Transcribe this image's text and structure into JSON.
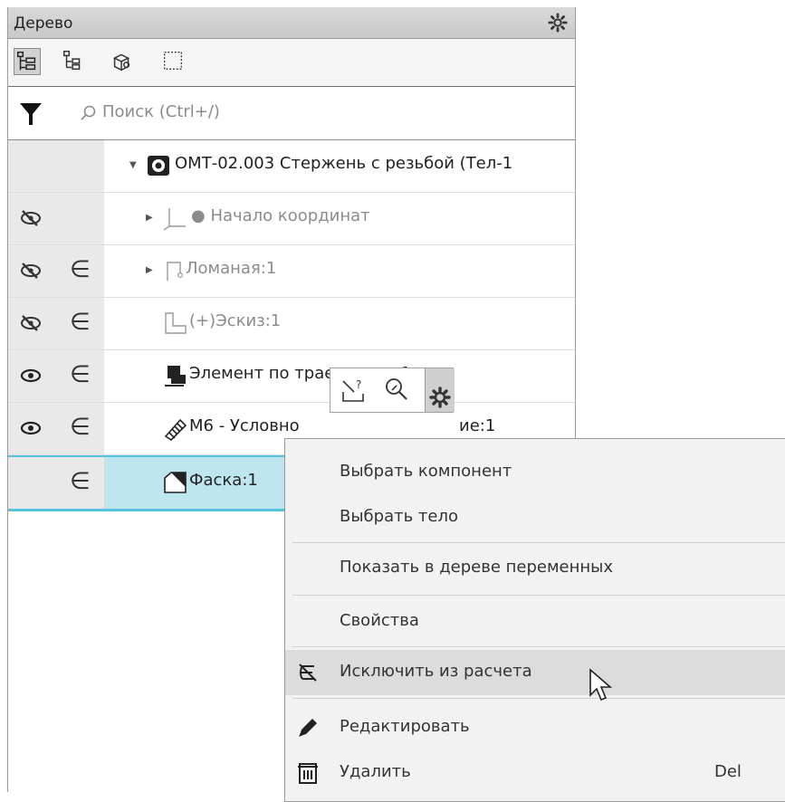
{
  "panel": {
    "title": "Дерево",
    "toolbar_buttons": [
      "structure-tree-icon",
      "hierarchy-tree-icon",
      "components-icon",
      "selection-frame-icon"
    ],
    "search_placeholder": "Поиск (Ctrl+/)"
  },
  "tree": [
    {
      "label": "ОМТ-02.003 Стержень с резьбой (Тел-1",
      "icon": "part-icon",
      "eye": "",
      "exclude": "",
      "expander": "open",
      "grayed": false
    },
    {
      "label": "Начало координат",
      "icon": "origin-icon",
      "eye": "hidden-eye-icon",
      "exclude": "",
      "expander": "closed",
      "grayed": true
    },
    {
      "label": "Ломаная:1",
      "icon": "polyline-icon",
      "eye": "hidden-eye-icon",
      "exclude": "∈",
      "expander": "closed",
      "grayed": true
    },
    {
      "label": "(+)Эскиз:1",
      "icon": "sketch-icon",
      "eye": "hidden-eye-icon",
      "exclude": "∈",
      "expander": "",
      "grayed": true
    },
    {
      "label": "Элемент по траектории:1",
      "icon": "sweep-icon",
      "eye": "eye-icon",
      "exclude": "∈",
      "expander": "",
      "grayed": false
    },
    {
      "label": "М6 - Условно",
      "label_tail": "ие:1",
      "icon": "thread-icon",
      "eye": "eye-icon",
      "exclude": "∈",
      "expander": "",
      "grayed": false
    },
    {
      "label": "Фаска:1",
      "icon": "chamfer-icon",
      "eye": "",
      "exclude": "∈",
      "expander": "",
      "grayed": false,
      "selected": true
    }
  ],
  "mini_toolbar": [
    "what-is-this-icon",
    "zoom-to-icon",
    "gear-icon"
  ],
  "context_menu": [
    {
      "label": "Выбрать компонент",
      "icon": "",
      "shortcut": ""
    },
    {
      "label": "Выбрать тело",
      "icon": "",
      "shortcut": ""
    },
    {
      "label": "Показать в дереве переменных",
      "icon": "",
      "shortcut": ""
    },
    {
      "label": "Свойства",
      "icon": "",
      "shortcut": ""
    },
    {
      "label": "Исключить из расчета",
      "icon": "exclude-icon",
      "shortcut": "",
      "hover": true
    },
    {
      "label": "Редактировать",
      "icon": "pencil-icon",
      "shortcut": ""
    },
    {
      "label": "Удалить",
      "icon": "trash-icon",
      "shortcut": "Del"
    }
  ],
  "colors": {
    "selection": "#bfe6ee",
    "selection_border": "#56c3dc",
    "menu_bg": "#f2f2f2",
    "hover": "#dcdcdc"
  }
}
